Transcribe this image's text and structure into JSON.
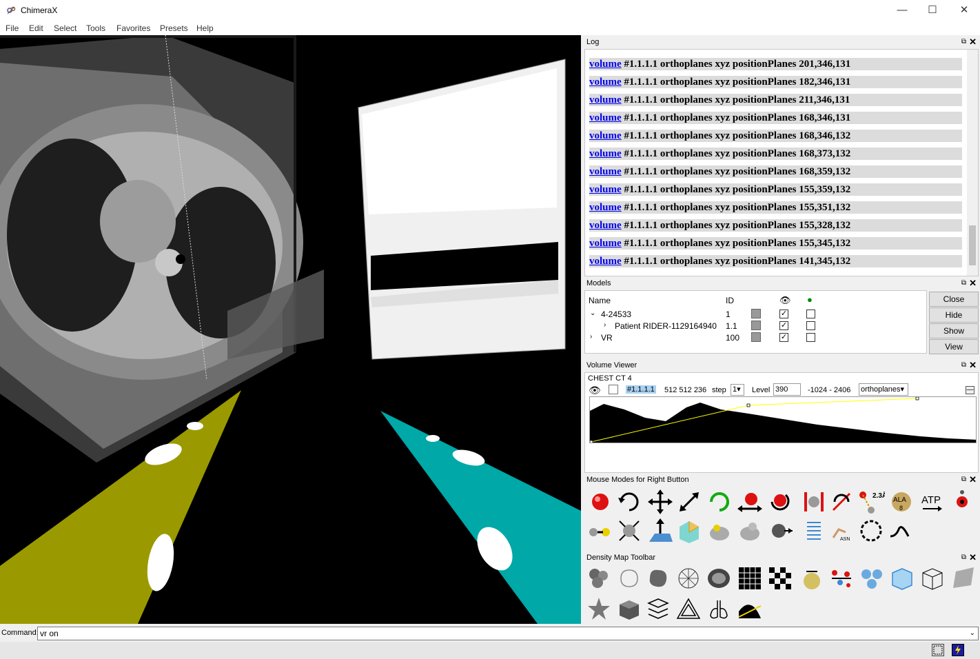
{
  "window": {
    "title": "ChimeraX",
    "minimize": "—",
    "maximize": "☐",
    "close": "✕"
  },
  "menu": [
    "File",
    "Edit",
    "Select",
    "Tools",
    "Favorites",
    "Presets",
    "Help"
  ],
  "log": {
    "title": "Log",
    "link_word": "volume",
    "lines": [
      "#1.1.1.1 orthoplanes xyz positionPlanes 201,346,131",
      "#1.1.1.1 orthoplanes xyz positionPlanes 182,346,131",
      "#1.1.1.1 orthoplanes xyz positionPlanes 211,346,131",
      "#1.1.1.1 orthoplanes xyz positionPlanes 168,346,131",
      "#1.1.1.1 orthoplanes xyz positionPlanes 168,346,132",
      "#1.1.1.1 orthoplanes xyz positionPlanes 168,373,132",
      "#1.1.1.1 orthoplanes xyz positionPlanes 168,359,132",
      "#1.1.1.1 orthoplanes xyz positionPlanes 155,359,132",
      "#1.1.1.1 orthoplanes xyz positionPlanes 155,351,132",
      "#1.1.1.1 orthoplanes xyz positionPlanes 155,328,132",
      "#1.1.1.1 orthoplanes xyz positionPlanes 155,345,132",
      "#1.1.1.1 orthoplanes xyz positionPlanes 141,345,132"
    ]
  },
  "models": {
    "title": "Models",
    "headers": {
      "name": "Name",
      "id": "ID"
    },
    "rows": [
      {
        "name": "4-24533",
        "id": "1"
      },
      {
        "name": "Patient RIDER-1129164940",
        "id": "1.1"
      },
      {
        "name": "VR",
        "id": "100"
      }
    ],
    "buttons": [
      "Close",
      "Hide",
      "Show",
      "View"
    ]
  },
  "volume_viewer": {
    "title": "Volume Viewer",
    "volume_name": "CHEST CT 4",
    "id": "#1.1.1.1",
    "size": "512 512 236",
    "step_label": "step",
    "step_value": "1",
    "level_label": "Level",
    "level_value": "390",
    "range": "-1024 - 2406",
    "style": "orthoplanes"
  },
  "mouse_modes": {
    "title": "Mouse Modes for Right Button",
    "label_23": "2.3Å",
    "label_ala": "ALA",
    "label_8": "8",
    "label_atp": "ATP",
    "label_asn": "ASN"
  },
  "density_toolbar": {
    "title": "Density Map Toolbar"
  },
  "command": {
    "label": "Command:",
    "value": "vr on"
  },
  "colors": {
    "accent_cyan": "#00a8a8",
    "accent_yellow": "#9a9a00",
    "link": "#0000ee"
  }
}
